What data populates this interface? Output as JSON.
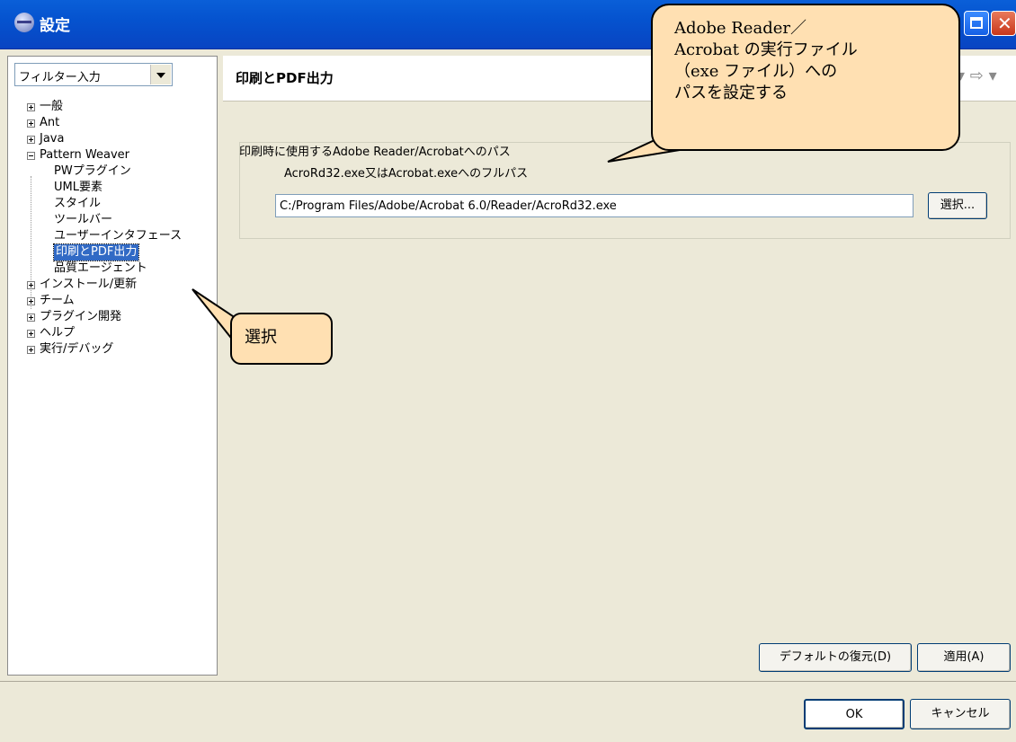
{
  "window": {
    "title": "設定"
  },
  "filter": {
    "value": "フィルター入力"
  },
  "tree": {
    "items": [
      {
        "label": "一般",
        "toggle": "plus"
      },
      {
        "label": "Ant",
        "toggle": "plus"
      },
      {
        "label": "Java",
        "toggle": "plus"
      },
      {
        "label": "Pattern Weaver",
        "toggle": "minus"
      },
      {
        "label": "PWプラグイン"
      },
      {
        "label": "UML要素"
      },
      {
        "label": "スタイル"
      },
      {
        "label": "ツールバー"
      },
      {
        "label": "ユーザーインタフェース"
      },
      {
        "label": "印刷とPDF出力",
        "selected": true
      },
      {
        "label": "品質エージェント"
      },
      {
        "label": "インストール/更新",
        "toggle": "plus"
      },
      {
        "label": "チーム",
        "toggle": "plus"
      },
      {
        "label": "プラグイン開発",
        "toggle": "plus"
      },
      {
        "label": "ヘルプ",
        "toggle": "plus"
      },
      {
        "label": "実行/デバッグ",
        "toggle": "plus"
      }
    ]
  },
  "page": {
    "title": "印刷とPDF出力",
    "group_legend": "印刷時に使用するAdobe Reader/Acrobatへのパス",
    "path_label": "AcroRd32.exe又はAcrobat.exeへのフルパス",
    "path_value": "C:/Program Files/Adobe/Acrobat 6.0/Reader/AcroRd32.exe",
    "browse_label": "選択..."
  },
  "buttons": {
    "restore": "デフォルトの復元(D)",
    "apply": "適用(A)",
    "ok": "OK",
    "cancel": "キャンセル"
  },
  "callouts": {
    "top_lines": [
      "Adobe Reader／",
      "Acrobat の実行ファイル",
      "（exe ファイル）への",
      "パスを設定する"
    ],
    "left": "選択"
  },
  "colors": {
    "titlebar": "#0553cf",
    "selection": "#316ac5",
    "callout_fill": "#ffe0b2"
  }
}
